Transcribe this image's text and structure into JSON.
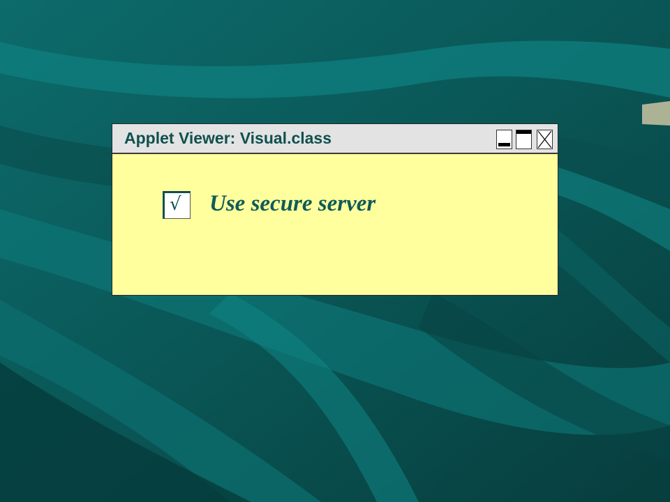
{
  "window": {
    "title": "Applet Viewer: Visual.class",
    "buttons": [
      "minimize",
      "maximize",
      "close"
    ]
  },
  "checkbox": {
    "label": "Use secure server",
    "mark": "√",
    "checked": true
  },
  "colors": {
    "background": "#0b5a5a",
    "content_background": "#ffff9e",
    "title_bar": "#e3e3e3",
    "text_teal": "#0f5b58"
  },
  "icons": [
    "minimize-icon",
    "maximize-icon",
    "close-icon",
    "check-icon"
  ]
}
